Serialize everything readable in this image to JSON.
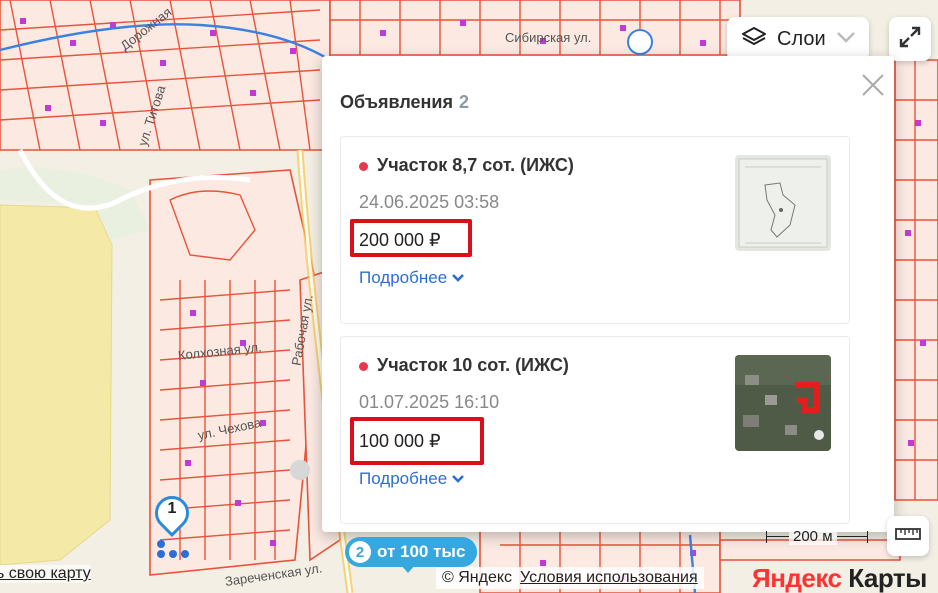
{
  "map": {
    "streets": [
      "Дорожная",
      "ул. Титова",
      "Сибирская ул.",
      "Рабочая ул.",
      "Колхозная ул.",
      "ул. Чехова",
      "Зареченская ул."
    ],
    "my_map_link": "ь свою карту",
    "cluster": {
      "count": "2",
      "label": "от 100 тыс"
    },
    "pin": {
      "count": "1"
    },
    "scale_label": "200 м",
    "copyright": "© Яндекс",
    "terms_link": "Условия использования",
    "brand": {
      "first": "Яндекс",
      "second": " Карты"
    }
  },
  "controls": {
    "layers_label": "Слои"
  },
  "panel": {
    "title": "Объявления",
    "count": "2",
    "listings": [
      {
        "title": "Участок 8,7 сот. (ИЖС)",
        "date": "24.06.2025 03:58",
        "price": "200 000 ₽",
        "more": "Подробнее"
      },
      {
        "title": "Участок 10 сот. (ИЖС)",
        "date": "01.07.2025 16:10",
        "price": "100 000 ₽",
        "more": "Подробнее"
      }
    ]
  },
  "colors": {
    "plot_stroke": "#e8533a",
    "plot_fill": "#fbe6dd",
    "river": "#3b82e0",
    "accent_blue": "#2b6fd6",
    "highlight_red": "#d8101a",
    "status_dot": "#e8384f",
    "cluster": "#36a8e0",
    "field_yellow": "#f5e9a8"
  }
}
